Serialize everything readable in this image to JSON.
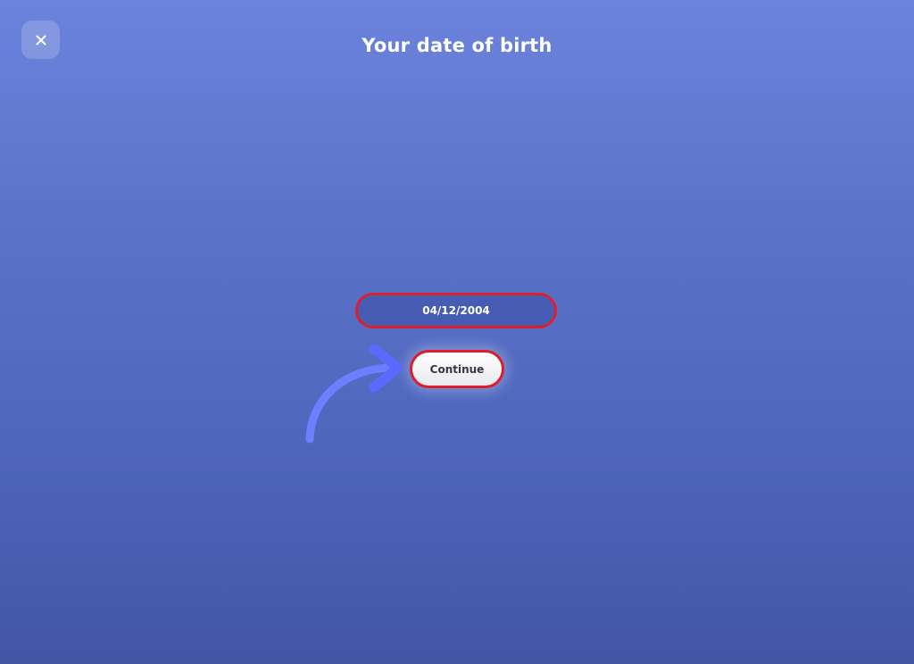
{
  "header": {
    "title": "Your date of birth",
    "close_icon": "close-icon"
  },
  "form": {
    "date_value": "04/12/2004",
    "continue_label": "Continue"
  },
  "decoration": {
    "arrow_icon": "curved-arrow-icon"
  },
  "colors": {
    "highlight_border": "#e01e2b",
    "arrow": "#6f7dff",
    "background_top": "#6c83dd",
    "background_bottom": "#4256a4"
  }
}
